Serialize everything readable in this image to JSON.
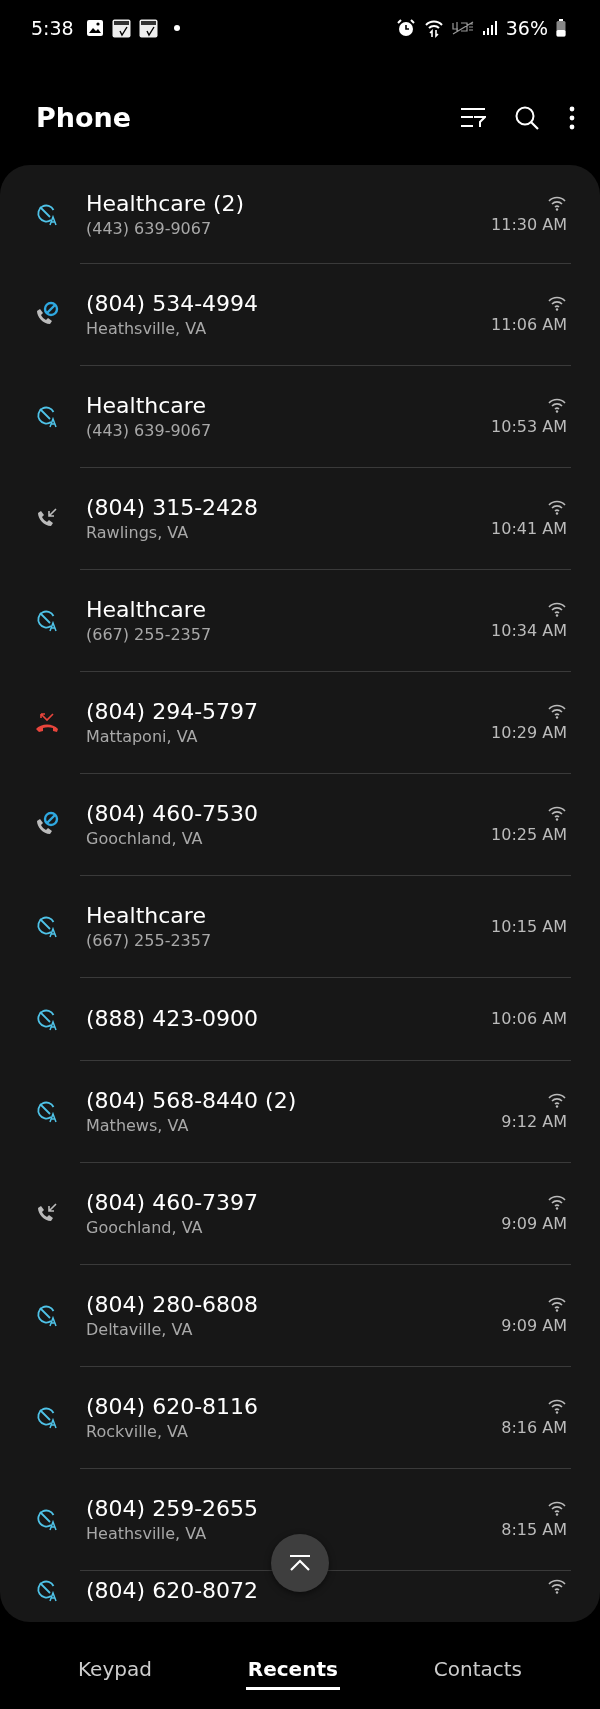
{
  "status_bar": {
    "time": "5:38",
    "battery": "36%"
  },
  "header": {
    "title": "Phone"
  },
  "calls": [
    {
      "kind": "filtered",
      "name": "Healthcare (2)",
      "detail": "(443) 639-9067",
      "time": "11:30 AM",
      "wifi": true
    },
    {
      "kind": "blocked",
      "name": "(804) 534-4994",
      "detail": "Heathsville, VA",
      "time": "11:06 AM",
      "wifi": true
    },
    {
      "kind": "filtered",
      "name": "Healthcare",
      "detail": "(443) 639-9067",
      "time": "10:53 AM",
      "wifi": true
    },
    {
      "kind": "incoming",
      "name": "(804) 315-2428",
      "detail": "Rawlings, VA",
      "time": "10:41 AM",
      "wifi": true
    },
    {
      "kind": "filtered",
      "name": "Healthcare",
      "detail": "(667) 255-2357",
      "time": "10:34 AM",
      "wifi": true
    },
    {
      "kind": "rejected",
      "name": "(804) 294-5797",
      "detail": "Mattaponi, VA",
      "time": "10:29 AM",
      "wifi": true
    },
    {
      "kind": "blocked",
      "name": "(804) 460-7530",
      "detail": "Goochland, VA",
      "time": "10:25 AM",
      "wifi": true
    },
    {
      "kind": "filtered",
      "name": "Healthcare",
      "detail": "(667) 255-2357",
      "time": "10:15 AM",
      "wifi": false
    },
    {
      "kind": "filtered",
      "name": "(888) 423-0900",
      "time": "10:06 AM",
      "wifi": false
    },
    {
      "kind": "filtered",
      "name": "(804) 568-8440 (2)",
      "detail": "Mathews, VA",
      "time": "9:12 AM",
      "wifi": true
    },
    {
      "kind": "incoming",
      "name": "(804) 460-7397",
      "detail": "Goochland, VA",
      "time": "9:09 AM",
      "wifi": true
    },
    {
      "kind": "filtered",
      "name": "(804) 280-6808",
      "detail": "Deltaville, VA",
      "time": "9:09 AM",
      "wifi": true
    },
    {
      "kind": "filtered",
      "name": "(804) 620-8116",
      "detail": "Rockville, VA",
      "time": "8:16 AM",
      "wifi": true
    },
    {
      "kind": "filtered",
      "name": "(804) 259-2655",
      "detail": "Heathsville, VA",
      "time": "8:15 AM",
      "wifi": true
    },
    {
      "kind": "filtered",
      "name": "(804) 620-8072",
      "wifi": true
    }
  ],
  "tabs": [
    {
      "label": "Keypad",
      "selected": false
    },
    {
      "label": "Recents",
      "selected": true
    },
    {
      "label": "Contacts",
      "selected": false
    }
  ]
}
